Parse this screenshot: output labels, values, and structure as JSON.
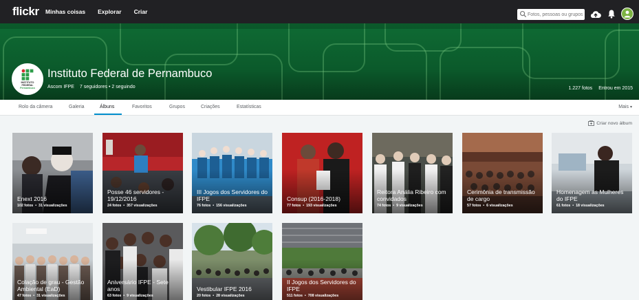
{
  "nav": {
    "logo": "flickr",
    "links": [
      "Minhas coisas",
      "Explorar",
      "Criar"
    ],
    "search_placeholder": "Fotos, pessoas ou grupos"
  },
  "profile": {
    "name": "Instituto Federal de Pernambuco",
    "username": "Ascom IFPE",
    "followers": "7 seguidores",
    "separator": "•",
    "following": "2 seguindo",
    "photos": "1.227 fotos",
    "joined": "Entrou em 2015",
    "buddy_lines": [
      "INSTITUTO",
      "FEDERAL",
      "Pernambuco"
    ]
  },
  "tabs": [
    "Rolo da câmera",
    "Galeria",
    "Álbuns",
    "Favoritos",
    "Grupos",
    "Criações",
    "Estatísticas"
  ],
  "active_tab": "Álbuns",
  "more_label": "Mais",
  "create_album_label": "Criar novo álbum",
  "albums": [
    {
      "title": "Enext 2016",
      "photos": "102 fotos",
      "views": "31 visualizações"
    },
    {
      "title": "Posse 46 servidores - 19/12/2016",
      "photos": "24 fotos",
      "views": "357 visualizações"
    },
    {
      "title": "III Jogos dos Servidores do IFPE",
      "photos": "76 fotos",
      "views": "156 visualizações"
    },
    {
      "title": "Consup (2016-2018)",
      "photos": "77 fotos",
      "views": "193 visualizações"
    },
    {
      "title": "Reitora Anália Ribeiro com convidados",
      "photos": "74 fotos",
      "views": "9 visualizações"
    },
    {
      "title": "Cerimônia de transmissão de cargo",
      "photos": "57 fotos",
      "views": "6 visualizações"
    },
    {
      "title": "Homenagem as Mulheres do IFPE",
      "photos": "61 fotos",
      "views": "18 visualizações"
    },
    {
      "title": "Colação de grau - Gestão Ambiental (EaD)",
      "photos": "47 fotos",
      "views": "31 visualizações"
    },
    {
      "title": "Aniversário IFPE - Sete anos",
      "photos": "63 fotos",
      "views": "9 visualizações"
    },
    {
      "title": "Vestibular IFPE 2016",
      "photos": "20 fotos",
      "views": "28 visualizações"
    },
    {
      "title": "II Jogos dos Servidores do IFPE",
      "photos": "511 fotos",
      "views": "708 visualizações"
    }
  ],
  "colors": {
    "topbar": "#212124",
    "cover": "#0b5a2b",
    "accent": "#008ecd",
    "background": "#f2f5f6"
  }
}
